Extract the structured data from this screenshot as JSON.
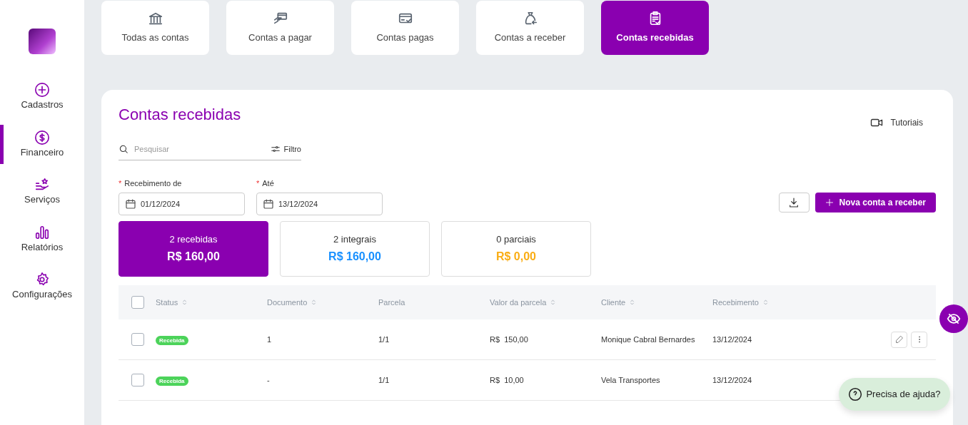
{
  "sidebar": {
    "items": [
      {
        "label": "Cadastros",
        "selected": false
      },
      {
        "label": "Financeiro",
        "selected": true
      },
      {
        "label": "Serviços",
        "selected": false
      },
      {
        "label": "Relatórios",
        "selected": false
      },
      {
        "label": "Configurações",
        "selected": false
      }
    ]
  },
  "tabs": [
    {
      "label": "Todas as contas",
      "selected": false
    },
    {
      "label": "Contas a pagar",
      "selected": false
    },
    {
      "label": "Contas pagas",
      "selected": false
    },
    {
      "label": "Contas a receber",
      "selected": false
    },
    {
      "label": "Contas recebidas",
      "selected": true
    }
  ],
  "page": {
    "title": "Contas recebidas",
    "tutorials": "Tutoriais",
    "search": {
      "placeholder": "Pesquisar"
    },
    "filter": "Filtro",
    "dates": [
      {
        "marker": "*",
        "label": "Recebimento de",
        "value": "01/12/2024"
      },
      {
        "marker": "*",
        "label": "Até",
        "value": "13/12/2024"
      }
    ],
    "new_button": "Nova conta a receber"
  },
  "stats": [
    {
      "label": "2 recebidas",
      "amount": "R$ 160,00",
      "color": "#ffffff",
      "selected": true
    },
    {
      "label": "2 integrais",
      "amount": "R$ 160,00",
      "color": "#1890ff",
      "selected": false
    },
    {
      "label": "0 parciais",
      "amount": "R$ 0,00",
      "color": "#faad14",
      "selected": false
    }
  ],
  "table": {
    "all_checked": false,
    "columns": [
      {
        "label": "Status",
        "sortable": true
      },
      {
        "label": "Documento",
        "sortable": true
      },
      {
        "label": "Parcela",
        "sortable": false
      },
      {
        "label": "Valor da parcela",
        "sortable": true
      },
      {
        "label": "Cliente",
        "sortable": true
      },
      {
        "label": "Recebimento",
        "sortable": true
      }
    ],
    "rows": [
      {
        "checked": false,
        "status": "Recebida",
        "document": "1",
        "installment": "1/1",
        "currency": "R$",
        "value": "150,00",
        "client": "Monique Cabral Bernardes",
        "date": "13/12/2024",
        "actions_visible": true
      },
      {
        "checked": false,
        "status": "Recebida",
        "document": "-",
        "installment": "1/1",
        "currency": "R$",
        "value": "10,00",
        "client": "Vela Transportes",
        "date": "13/12/2024",
        "actions_visible": false
      }
    ]
  },
  "help": "Precisa de ajuda?"
}
